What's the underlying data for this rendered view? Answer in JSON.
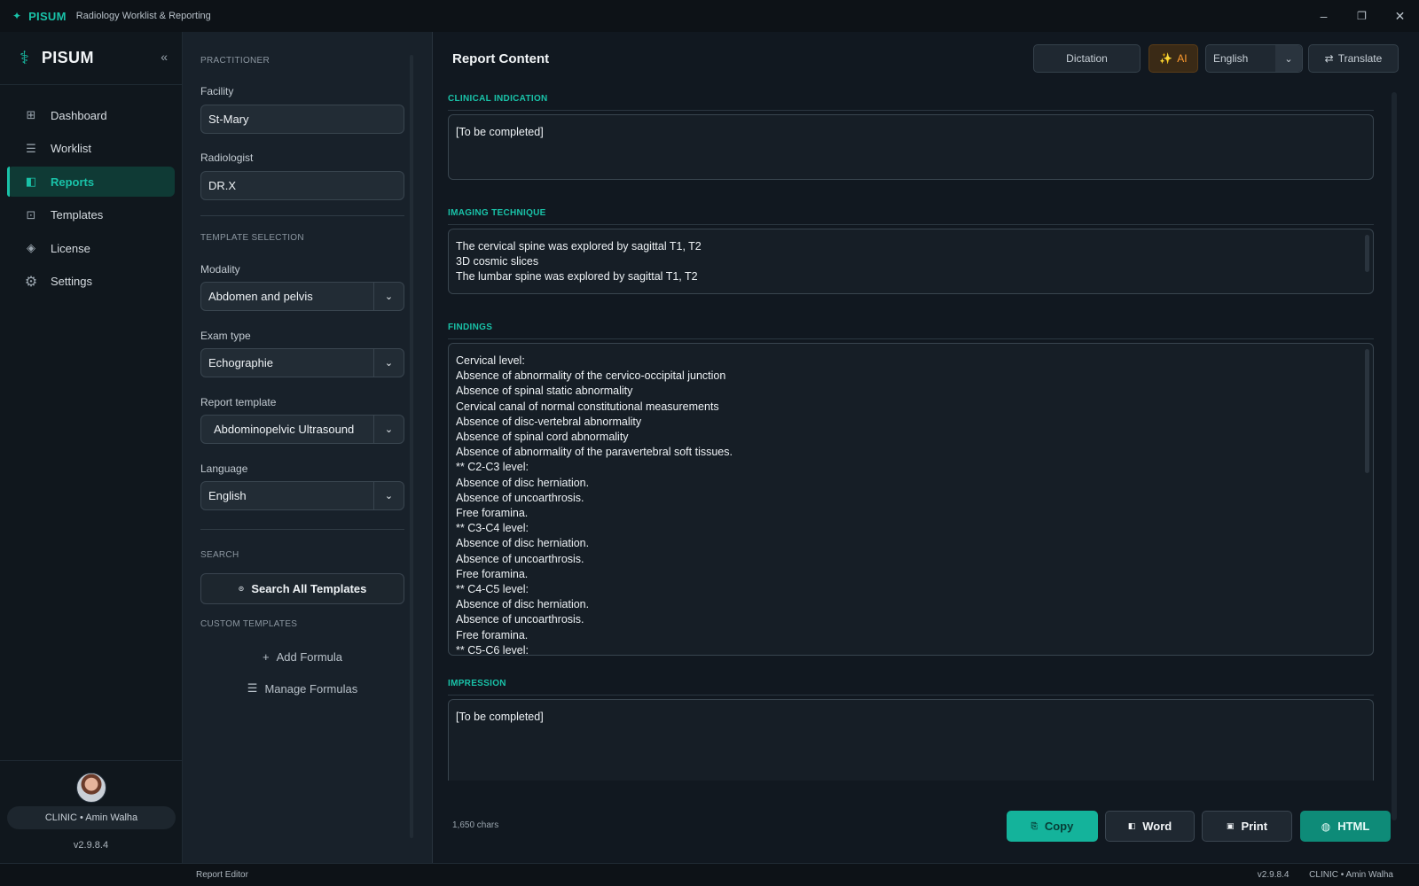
{
  "window": {
    "app_name": "PISUM",
    "subtitle": "Radiology Worklist & Reporting",
    "logo_icon": "✦",
    "minimize": "–",
    "maximize": "❐",
    "close": "✕"
  },
  "sidebar": {
    "brand": "PISUM",
    "brand_icon": "⚕",
    "collapse": "«",
    "items": [
      {
        "label": "Dashboard",
        "icon": "⊞",
        "active": false
      },
      {
        "label": "Worklist",
        "icon": "☰",
        "active": false
      },
      {
        "label": "Reports",
        "icon": "◧",
        "active": true
      },
      {
        "label": "Templates",
        "icon": "⊡",
        "active": false
      },
      {
        "label": "License",
        "icon": "◈",
        "active": false
      },
      {
        "label": "Settings",
        "icon": "⚙",
        "active": false
      }
    ],
    "user": "CLINIC  •  Amin Walha",
    "version": "v2.9.8.4"
  },
  "form": {
    "practitioner_section": "PRACTITIONER",
    "facility_label": "Facility",
    "facility_value": "St-Mary",
    "radiologist_label": "Radiologist",
    "radiologist_value": "DR.X",
    "template_section": "TEMPLATE SELECTION",
    "modality_label": "Modality",
    "modality_value": "Abdomen and pelvis",
    "exam_label": "Exam type",
    "exam_value": "Echographie",
    "template_label": "Report template",
    "template_value": "Abdominopelvic Ultrasound",
    "language_label": "Language",
    "language_value": "English",
    "search_section": "SEARCH",
    "search_button": "Search All Templates",
    "custom_section": "CUSTOM TEMPLATES",
    "add_formula": "Add Formula",
    "manage_formulas": "Manage Formulas",
    "chevron": "⌄"
  },
  "main": {
    "title": "Report Content",
    "dictation": "Dictation",
    "ai_icon": "✨",
    "ai": "AI",
    "language": "English",
    "translate_icon": "⇄",
    "translate": "Translate",
    "sections": {
      "clinical": {
        "title": "CLINICAL INDICATION",
        "lines": [
          "[To be completed]"
        ]
      },
      "technique": {
        "title": "IMAGING TECHNIQUE",
        "lines": [
          "The cervical spine was explored by sagittal T1, T2",
          "3D cosmic slices",
          "The lumbar spine was explored by sagittal T1, T2"
        ]
      },
      "findings": {
        "title": "FINDINGS",
        "lines": [
          "Cervical level:",
          "Absence of abnormality of the cervico-occipital junction",
          "Absence of spinal static abnormality",
          "Cervical canal of normal constitutional measurements",
          "Absence of disc-vertebral abnormality",
          "Absence of spinal cord abnormality",
          "Absence of abnormality of the paravertebral soft tissues.",
          "** C2-C3 level:",
          "Absence of disc herniation.",
          "Absence of uncoarthrosis.",
          "Free foramina.",
          "** C3-C4 level:",
          "Absence of disc herniation.",
          "Absence of uncoarthrosis.",
          "Free foramina.",
          "** C4-C5 level:",
          "Absence of disc herniation.",
          "Absence of uncoarthrosis.",
          "Free foramina.",
          "** C5-C6 level:"
        ]
      },
      "impression": {
        "title": "IMPRESSION",
        "lines": [
          "[To be completed]"
        ]
      }
    },
    "chars": "1,650 chars",
    "copy": "Copy",
    "word": "Word",
    "print": "Print",
    "html": "HTML"
  },
  "statusbar": {
    "left": "Report Editor",
    "version": "v2.9.8.4",
    "user": "CLINIC  •  Amin Walha"
  },
  "colors": {
    "accent": "#19c2a8",
    "ai": "#ff9b2f",
    "background": "#111820"
  }
}
